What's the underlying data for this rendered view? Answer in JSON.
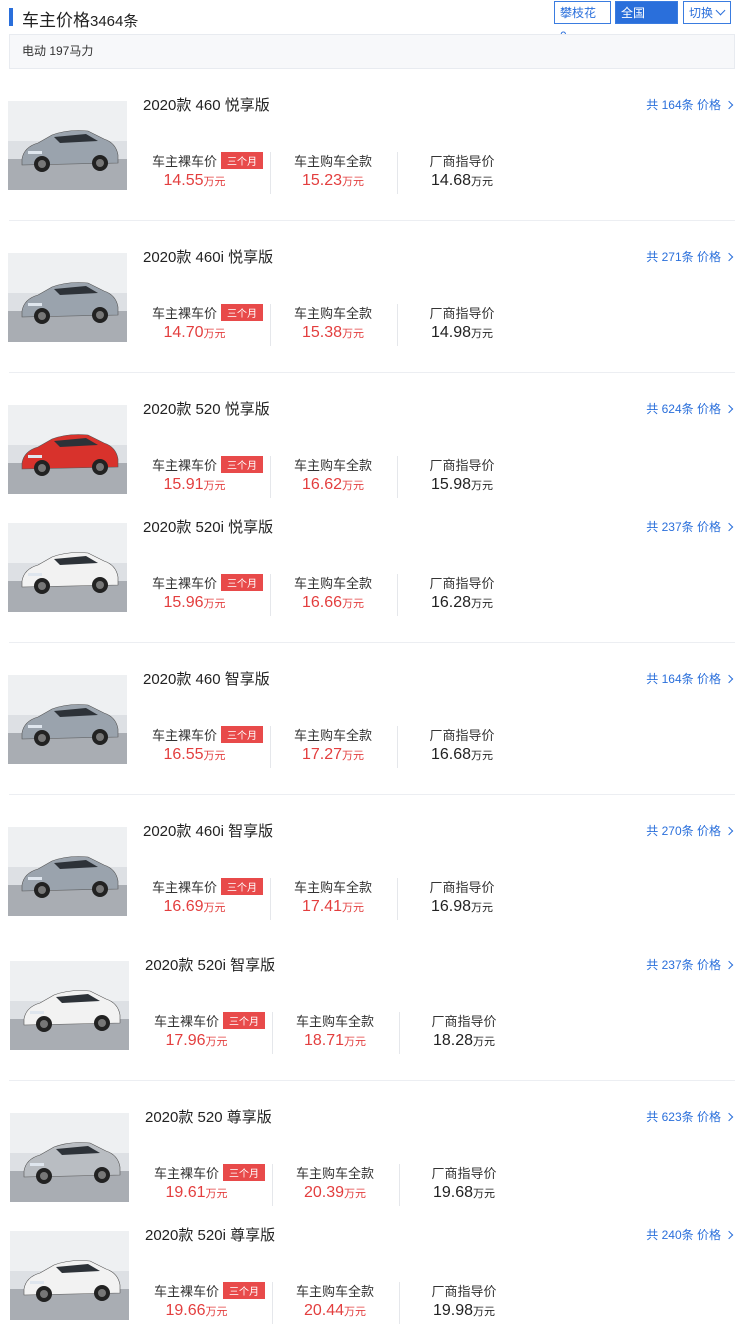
{
  "header": {
    "title": "车主价格",
    "count": "3464条",
    "local_btn": "攀枝花 0",
    "all_btn": "全国 3464",
    "switch_btn": "切换"
  },
  "filter": {
    "text": "电动 197马力"
  },
  "labels": {
    "naked": "车主裸车价",
    "badge": "三个月",
    "total": "车主购车全款",
    "guide": "厂商指导价",
    "unit": "万元"
  },
  "items": [
    {
      "name": "2020款 460 悦享版",
      "link": "共 164条 价格",
      "naked": "14.55",
      "total": "15.23",
      "guide": "14.68",
      "color": "#9aa3ad"
    },
    {
      "name": "2020款 460i 悦享版",
      "link": "共 271条 价格",
      "naked": "14.70",
      "total": "15.38",
      "guide": "14.98",
      "color": "#9aa3ad"
    },
    {
      "name": "2020款 520 悦享版",
      "link": "共 624条 价格",
      "naked": "15.91",
      "total": "16.62",
      "guide": "15.98",
      "color": "#d8322c"
    },
    {
      "name": "2020款 520i 悦享版",
      "link": "共 237条 价格",
      "naked": "15.96",
      "total": "16.66",
      "guide": "16.28",
      "color": "#f2f2f2"
    },
    {
      "name": "2020款 460 智享版",
      "link": "共 164条 价格",
      "naked": "16.55",
      "total": "17.27",
      "guide": "16.68",
      "color": "#9aa3ad"
    },
    {
      "name": "2020款 460i 智享版",
      "link": "共 270条 价格",
      "naked": "16.69",
      "total": "17.41",
      "guide": "16.98",
      "color": "#9aa3ad"
    },
    {
      "name": "2020款 520i 智享版",
      "link": "共 237条 价格",
      "naked": "17.96",
      "total": "18.71",
      "guide": "18.28",
      "color": "#f2f2f2"
    },
    {
      "name": "2020款 520 尊享版",
      "link": "共 623条 价格",
      "naked": "19.61",
      "total": "20.39",
      "guide": "19.68",
      "color": "#b9bdc2"
    },
    {
      "name": "2020款 520i 尊享版",
      "link": "共 240条 价格",
      "naked": "19.66",
      "total": "20.44",
      "guide": "19.98",
      "color": "#f2f2f2"
    }
  ]
}
